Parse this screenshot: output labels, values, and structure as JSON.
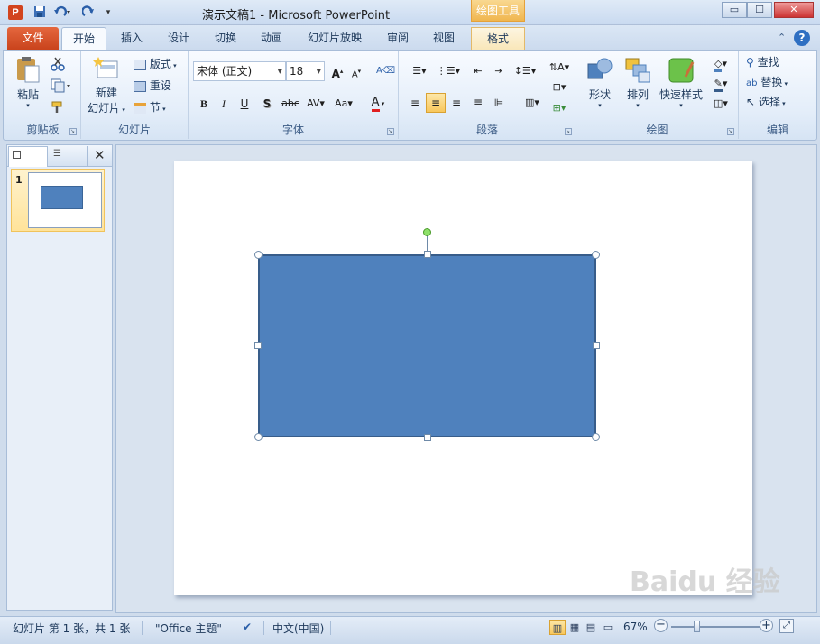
{
  "window": {
    "title": "演示文稿1 - Microsoft PowerPoint",
    "app_icon_letter": "P",
    "context_tab_header": "绘图工具",
    "controls": {
      "minimize": "▭",
      "maximize": "☐",
      "close": "✕"
    }
  },
  "quick_access": [
    "save-icon",
    "undo-icon",
    "redo-icon",
    "customize-icon"
  ],
  "tabs": [
    {
      "label": "文件"
    },
    {
      "label": "开始"
    },
    {
      "label": "插入"
    },
    {
      "label": "设计"
    },
    {
      "label": "切换"
    },
    {
      "label": "动画"
    },
    {
      "label": "幻灯片放映"
    },
    {
      "label": "审阅"
    },
    {
      "label": "视图"
    },
    {
      "label": "格式"
    }
  ],
  "ribbon": {
    "clipboard": {
      "label": "剪贴板",
      "paste": "粘贴"
    },
    "slides": {
      "label": "幻灯片",
      "new_slide": "新建",
      "new_slide2": "幻灯片",
      "layout": "版式",
      "reset": "重设",
      "section": "节"
    },
    "font": {
      "label": "字体",
      "font_name": "宋体 (正文)",
      "font_size": "18"
    },
    "paragraph": {
      "label": "段落"
    },
    "drawing": {
      "label": "绘图",
      "shapes": "形状",
      "arrange": "排列",
      "quick_styles": "快速样式"
    },
    "editing": {
      "label": "编辑",
      "find": "查找",
      "replace": "替换",
      "select": "选择"
    }
  },
  "slides_panel": {
    "slide_number": "1"
  },
  "status": {
    "slide_info": "幻灯片 第 1 张，共 1 张",
    "theme": "\"Office 主题\"",
    "language": "中文(中国)",
    "zoom": "67%"
  },
  "watermark": "Baidu 经验",
  "colors": {
    "shape_fill": "#4f81bd",
    "file_tab": "#d9542b",
    "context_tab": "#f0b64f"
  }
}
